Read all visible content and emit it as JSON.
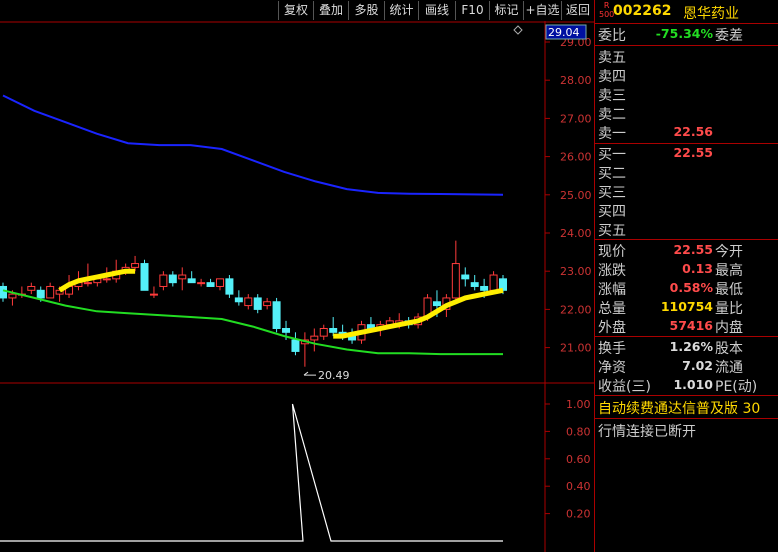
{
  "toolbar": {
    "buttons": [
      "复权",
      "叠加",
      "多股",
      "统计",
      "画线",
      "F10",
      "标记",
      "+自选",
      "返回"
    ]
  },
  "chart": {
    "price_ticks": [
      "29.00",
      "28.00",
      "27.00",
      "26.00",
      "25.00",
      "24.00",
      "23.00",
      "22.00",
      "21.00"
    ],
    "current_price_box": "29.04",
    "low_annotation": "20.49",
    "indicator_ticks": [
      "1.00",
      "0.80",
      "0.60",
      "0.40",
      "0.20"
    ]
  },
  "chart_data": {
    "type": "candlestick",
    "y_range": [
      20.0,
      29.5
    ],
    "candles": [
      [
        22.6,
        22.7,
        22.2,
        22.3
      ],
      [
        22.3,
        22.5,
        22.1,
        22.4
      ],
      [
        22.4,
        22.6,
        22.3,
        22.4
      ],
      [
        22.5,
        22.7,
        22.4,
        22.6
      ],
      [
        22.5,
        22.6,
        22.2,
        22.3
      ],
      [
        22.3,
        22.7,
        22.3,
        22.6
      ],
      [
        22.4,
        22.6,
        22.2,
        22.5
      ],
      [
        22.4,
        22.9,
        22.3,
        22.6
      ],
      [
        22.6,
        23.0,
        22.5,
        22.7
      ],
      [
        22.7,
        23.2,
        22.6,
        22.7
      ],
      [
        22.7,
        22.8,
        22.6,
        22.8
      ],
      [
        22.8,
        23.1,
        22.7,
        22.8
      ],
      [
        22.8,
        23.3,
        22.7,
        23.0
      ],
      [
        23.0,
        23.2,
        22.9,
        23.1
      ],
      [
        23.1,
        23.4,
        23.0,
        23.2
      ],
      [
        23.2,
        23.3,
        22.5,
        22.5
      ],
      [
        22.4,
        22.6,
        22.3,
        22.4
      ],
      [
        22.6,
        23.0,
        22.5,
        22.9
      ],
      [
        22.9,
        23.0,
        22.6,
        22.7
      ],
      [
        22.8,
        23.1,
        22.5,
        22.9
      ],
      [
        22.8,
        23.0,
        22.7,
        22.7
      ],
      [
        22.7,
        22.8,
        22.6,
        22.7
      ],
      [
        22.7,
        22.8,
        22.6,
        22.6
      ],
      [
        22.6,
        22.8,
        22.5,
        22.8
      ],
      [
        22.8,
        22.9,
        22.3,
        22.4
      ],
      [
        22.3,
        22.5,
        22.1,
        22.2
      ],
      [
        22.1,
        22.4,
        22.0,
        22.3
      ],
      [
        22.3,
        22.4,
        21.9,
        22.0
      ],
      [
        22.1,
        22.3,
        22.0,
        22.2
      ],
      [
        22.2,
        22.3,
        21.4,
        21.5
      ],
      [
        21.5,
        21.7,
        21.2,
        21.4
      ],
      [
        21.2,
        21.4,
        20.8,
        20.9
      ],
      [
        21.1,
        21.4,
        20.5,
        21.2
      ],
      [
        21.2,
        21.5,
        20.9,
        21.3
      ],
      [
        21.3,
        21.6,
        21.2,
        21.5
      ],
      [
        21.5,
        21.8,
        21.3,
        21.4
      ],
      [
        21.4,
        21.6,
        21.2,
        21.3
      ],
      [
        21.3,
        21.5,
        21.1,
        21.2
      ],
      [
        21.2,
        21.7,
        21.1,
        21.6
      ],
      [
        21.6,
        21.8,
        21.4,
        21.5
      ],
      [
        21.5,
        21.7,
        21.3,
        21.6
      ],
      [
        21.6,
        21.8,
        21.5,
        21.7
      ],
      [
        21.6,
        21.9,
        21.5,
        21.7
      ],
      [
        21.7,
        21.8,
        21.5,
        21.6
      ],
      [
        21.6,
        21.9,
        21.5,
        21.8
      ],
      [
        21.8,
        22.4,
        21.7,
        22.3
      ],
      [
        22.2,
        22.5,
        21.8,
        22.1
      ],
      [
        22.0,
        22.4,
        21.8,
        22.3
      ],
      [
        22.3,
        23.8,
        22.2,
        23.2
      ],
      [
        22.9,
        23.1,
        22.6,
        22.8
      ],
      [
        22.7,
        22.9,
        22.5,
        22.6
      ],
      [
        22.6,
        22.8,
        22.3,
        22.5
      ],
      [
        22.5,
        23.0,
        22.4,
        22.9
      ],
      [
        22.8,
        22.9,
        22.4,
        22.5
      ]
    ],
    "ma_blue": [
      27.6,
      27.2,
      26.9,
      26.6,
      26.35,
      26.3,
      26.3,
      26.2,
      25.9,
      25.6,
      25.35,
      25.15,
      25.05,
      25.03,
      25.02,
      25.01,
      25.0
    ],
    "ma_green": [
      22.5,
      22.3,
      22.1,
      21.95,
      21.9,
      21.85,
      21.8,
      21.75,
      21.55,
      21.3,
      21.1,
      20.95,
      20.85,
      20.85,
      20.83,
      20.83,
      20.83
    ],
    "ma_yellow": [
      null,
      null,
      null,
      null,
      null,
      null,
      22.5,
      22.65,
      22.75,
      22.8,
      22.85,
      22.9,
      22.95,
      23.0,
      23.0,
      null,
      null,
      null,
      null,
      null,
      null,
      null,
      null,
      null,
      null,
      null,
      null,
      null,
      null,
      null,
      null,
      null,
      null,
      null,
      null,
      21.3,
      21.3,
      21.35,
      21.4,
      21.45,
      21.5,
      21.55,
      21.6,
      21.65,
      21.7,
      21.8,
      21.95,
      22.1,
      22.2,
      22.3,
      22.35,
      22.4,
      22.45,
      22.5
    ],
    "indicator": {
      "y_range": [
        0,
        1.0
      ],
      "spike_at_fraction": 0.535,
      "spike_value": 1.0
    }
  },
  "side": {
    "badge_top": "R",
    "badge_bottom": "500",
    "code": "002262",
    "name": "恩华药业",
    "weibi_label": "委比",
    "weibi_value": "-75.34%",
    "weicha_label": "委差",
    "sells": [
      "卖五",
      "卖四",
      "卖三",
      "卖二",
      "卖一"
    ],
    "sell1_value": "22.56",
    "buys": [
      "买一",
      "买二",
      "买三",
      "买四",
      "买五"
    ],
    "buy1_value": "22.55",
    "quote": [
      {
        "l": "现价",
        "v": "22.55",
        "c": "#ff4b4b",
        "r": "今开"
      },
      {
        "l": "涨跌",
        "v": "0.13",
        "c": "#ff4b4b",
        "r": "最高"
      },
      {
        "l": "涨幅",
        "v": "0.58%",
        "c": "#ff4b4b",
        "r": "最低"
      },
      {
        "l": "总量",
        "v": "110754",
        "c": "#ffd800",
        "r": "量比"
      },
      {
        "l": "外盘",
        "v": "57416",
        "c": "#ff4b4b",
        "r": "内盘"
      }
    ],
    "fund": [
      {
        "l": "换手",
        "v": "1.26%",
        "c": "#dcdcdc",
        "r": "股本"
      },
      {
        "l": "净资",
        "v": "7.02",
        "c": "#dcdcdc",
        "r": "流通"
      },
      {
        "l": "收益(三)",
        "v": "1.010",
        "c": "#dcdcdc",
        "r": "PE(动)"
      }
    ],
    "marquee": "自动续费通达信普及版  30",
    "status": "行情连接已断开"
  }
}
